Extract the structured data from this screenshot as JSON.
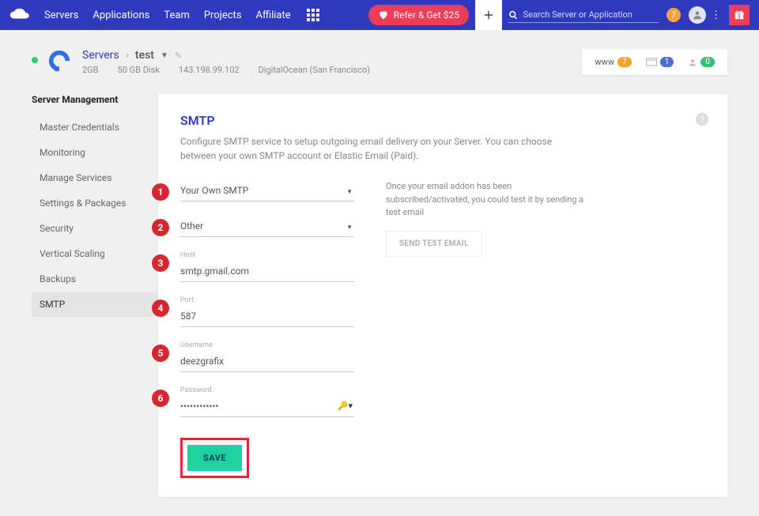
{
  "nav": {
    "servers": "Servers",
    "applications": "Applications",
    "team": "Team",
    "projects": "Projects",
    "affiliate": "Affiliate",
    "refer": "Refer & Get $25",
    "search_placeholder": "Search Server or Application",
    "notif_count": "7"
  },
  "server": {
    "breadcrumb_root": "Servers",
    "name": "test",
    "ram": "2GB",
    "disk": "50 GB Disk",
    "ip": "143.198.99.102",
    "provider": "DigitalOcean (San Francisco)"
  },
  "header_badges": {
    "www_label": "www",
    "www_count": "7",
    "apps_count": "1",
    "users_count": "0"
  },
  "sidebar": {
    "heading": "Server Management",
    "items": [
      "Master Credentials",
      "Monitoring",
      "Manage Services",
      "Settings & Packages",
      "Security",
      "Vertical Scaling",
      "Backups",
      "SMTP"
    ],
    "active": "SMTP"
  },
  "panel": {
    "title": "SMTP",
    "desc": "Configure SMTP service to setup outgoing email delivery on your Server. You can choose between your own SMTP account or Elastic Email (Paid).",
    "right_text": "Once your email addon has been subscribed/activated, you could test it by sending a test email",
    "test_btn": "SEND TEST EMAIL",
    "save": "SAVE"
  },
  "form": {
    "provider": {
      "value": "Your Own SMTP"
    },
    "type": {
      "value": "Other"
    },
    "host": {
      "label": "Host",
      "value": "smtp.gmail.com"
    },
    "port": {
      "label": "Port",
      "value": "587"
    },
    "username": {
      "label": "Username",
      "value": "deezgrafix"
    },
    "password": {
      "label": "Password",
      "value": "••••••••••••"
    }
  },
  "steps": [
    "1",
    "2",
    "3",
    "4",
    "5",
    "6"
  ]
}
